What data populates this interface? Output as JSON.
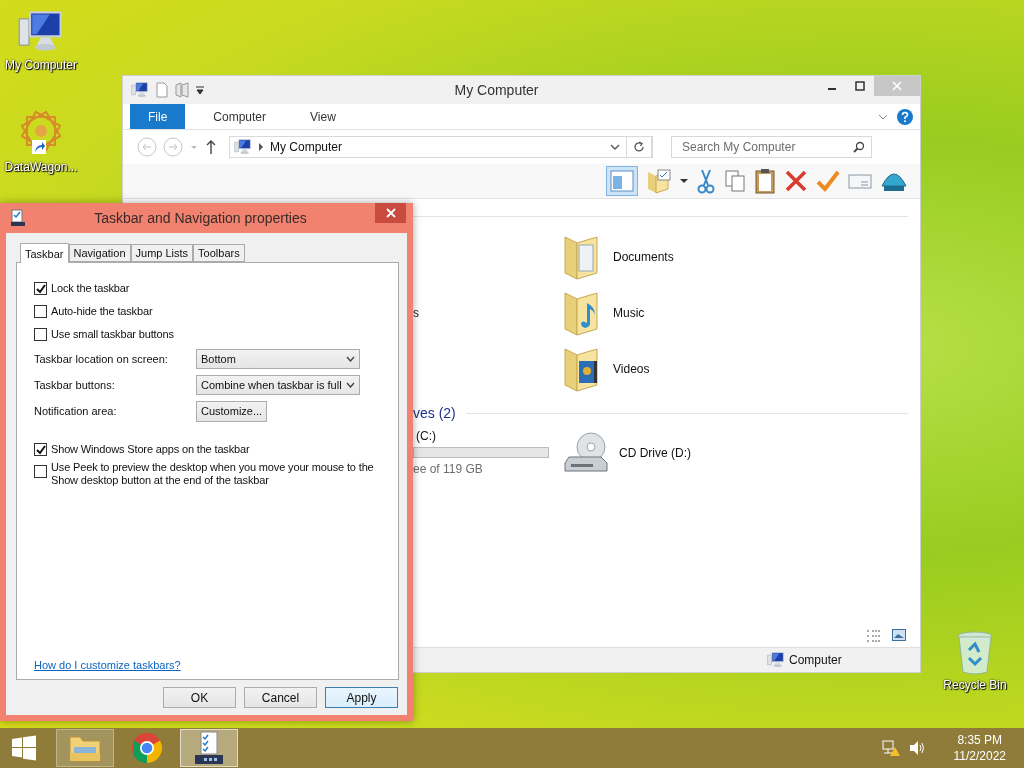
{
  "desktop_icons": [
    {
      "kind": "computer",
      "label": "My Computer"
    },
    {
      "kind": "shortcut",
      "label": "DataWagon..."
    },
    {
      "kind": "recycle",
      "label": "Recycle Bin"
    }
  ],
  "explorer": {
    "title": "My Computer",
    "ribbon_tabs": [
      {
        "label": "File",
        "selected": true
      },
      {
        "label": "Computer",
        "selected": false
      },
      {
        "label": "View",
        "selected": false
      }
    ],
    "address": "My Computer",
    "search": {
      "placeholder": "Search My Computer"
    },
    "pane_toggle_on": true,
    "folders": [
      {
        "kind": "documents",
        "name": "Documents"
      },
      {
        "kind": "music",
        "name": "Music",
        "side_text": "s"
      },
      {
        "kind": "videos",
        "name": "Videos"
      }
    ],
    "drives_header": "ves (2)",
    "drives": [
      {
        "kind": "hdd",
        "name": "(C:)",
        "detail": "ee of 119 GB"
      },
      {
        "kind": "cd",
        "name": "CD Drive (D:)"
      }
    ],
    "status": "Computer"
  },
  "dialog": {
    "title": "Taskbar and Navigation properties",
    "tabs": [
      {
        "label": "Taskbar",
        "selected": true
      },
      {
        "label": "Navigation",
        "selected": false
      },
      {
        "label": "Jump Lists",
        "selected": false
      },
      {
        "label": "Toolbars",
        "selected": false
      }
    ],
    "options": [
      {
        "kind": "checkbox",
        "label": "Lock the taskbar",
        "checked": true
      },
      {
        "kind": "checkbox",
        "label": "Auto-hide the taskbar",
        "checked": false
      },
      {
        "kind": "checkbox",
        "label": "Use small taskbar buttons",
        "checked": false
      },
      {
        "kind": "select",
        "label": "Taskbar location on screen:",
        "value": "Bottom"
      },
      {
        "kind": "select",
        "label": "Taskbar buttons:",
        "value": "Combine when taskbar is full"
      },
      {
        "kind": "button",
        "label": "Notification area:",
        "value": "Customize..."
      },
      {
        "kind": "checkbox",
        "label": "Show Windows Store apps on the taskbar",
        "checked": true
      },
      {
        "kind": "checkbox",
        "label": "Use Peek to preview the desktop when you move your mouse to the Show desktop button at the end of the taskbar",
        "checked": false
      }
    ],
    "help_link": "How do I customize taskbars?",
    "buttons": [
      {
        "label": "OK",
        "default": false
      },
      {
        "label": "Cancel",
        "default": false
      },
      {
        "label": "Apply",
        "default": true
      }
    ]
  },
  "taskbar": {
    "apps": [
      {
        "kind": "explorer",
        "running": true,
        "selected": false
      },
      {
        "kind": "chrome",
        "running": false,
        "selected": false
      },
      {
        "kind": "properties",
        "running": true,
        "selected": true
      }
    ],
    "time": "8:35 PM",
    "date": "11/2/2022"
  }
}
